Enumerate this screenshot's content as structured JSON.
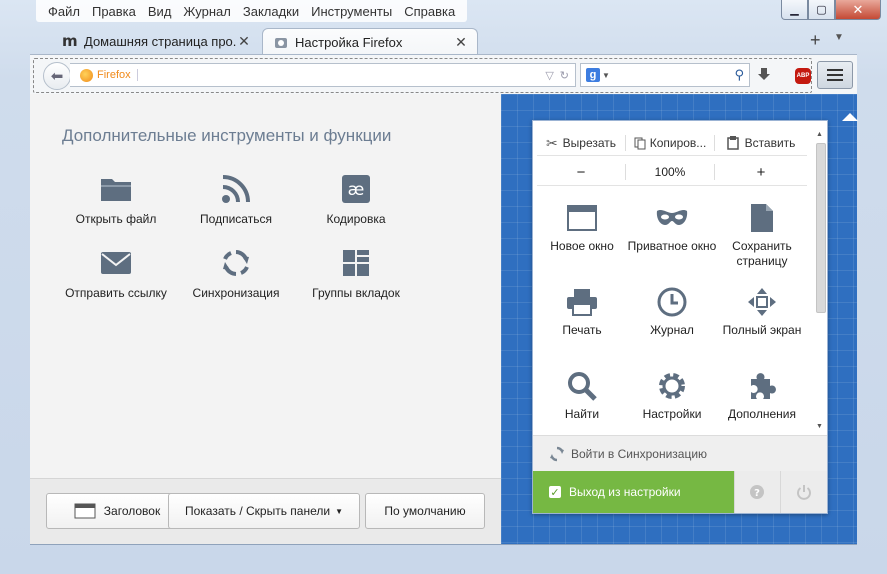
{
  "menubar": [
    "Файл",
    "Правка",
    "Вид",
    "Журнал",
    "Закладки",
    "Инструменты",
    "Справка"
  ],
  "window_controls": {
    "minimize_icon": "minimize-icon",
    "maximize_icon": "maximize-icon",
    "close_icon": "close-icon"
  },
  "tabs": [
    {
      "title": "Домашняя страница про...",
      "icon": "m-logo-icon"
    },
    {
      "title": "Настройка Firefox",
      "icon": "customize-icon"
    }
  ],
  "toolbar": {
    "identity_label": "Firefox",
    "url_value": "",
    "search_value": "",
    "search_engine": "g"
  },
  "left_panel": {
    "heading": "Дополнительные инструменты и функции",
    "tools": [
      {
        "label": "Открыть файл",
        "icon": "folder-icon"
      },
      {
        "label": "Подписаться",
        "icon": "rss-icon"
      },
      {
        "label": "Кодировка",
        "icon": "encoding-icon",
        "glyph": "æ"
      },
      {
        "label": "Отправить ссылку",
        "icon": "mail-icon"
      },
      {
        "label": "Синхронизация",
        "icon": "sync-icon"
      },
      {
        "label": "Группы вкладок",
        "icon": "tab-groups-icon"
      }
    ]
  },
  "bottom_bar": {
    "title_label": "Заголовок",
    "toolbars_label": "Показать / Скрыть панели",
    "defaults_label": "По умолчанию"
  },
  "panel": {
    "cut": "Вырезать",
    "copy": "Копиров...",
    "paste": "Вставить",
    "zoom_out": "−",
    "zoom_level": "100%",
    "zoom_in": "+",
    "items": [
      {
        "label": "Новое окно",
        "icon": "new-window-icon"
      },
      {
        "label": "Приватное окно",
        "icon": "private-mask-icon"
      },
      {
        "label": "Сохранить страницу",
        "icon": "save-page-icon"
      },
      {
        "label": "Печать",
        "icon": "print-icon"
      },
      {
        "label": "Журнал",
        "icon": "history-clock-icon"
      },
      {
        "label": "Полный экран",
        "icon": "fullscreen-icon"
      },
      {
        "label": "Найти",
        "icon": "find-icon"
      },
      {
        "label": "Настройки",
        "icon": "settings-gear-icon"
      },
      {
        "label": "Дополнения",
        "icon": "addons-puzzle-icon"
      }
    ],
    "sync_label": "Войти в Синхронизацию",
    "exit_label": "Выход из настройки"
  },
  "colors": {
    "accent_blue": "#2f6fc0",
    "exit_green": "#76b843",
    "heading": "#6c7d92",
    "icon_gray": "#5e6e80"
  }
}
